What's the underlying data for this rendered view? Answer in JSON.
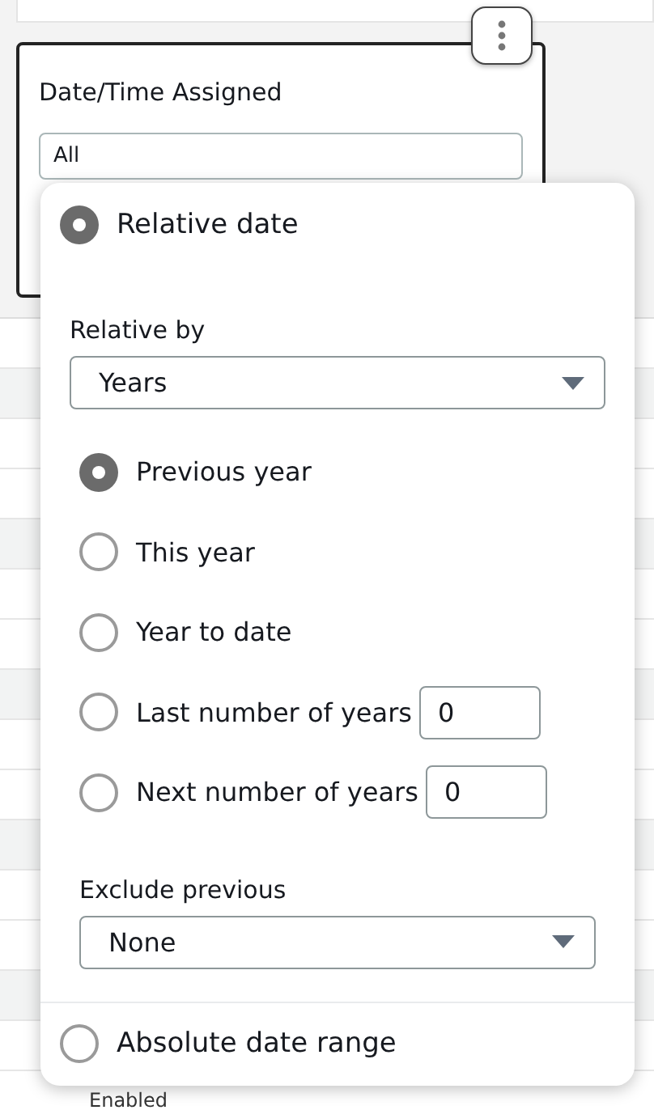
{
  "filter_card": {
    "title": "Date/Time Assigned",
    "value": "All"
  },
  "popup": {
    "modes": [
      {
        "label": "Relative date",
        "selected": true
      },
      {
        "label": "Absolute date range",
        "selected": false
      }
    ],
    "relative_by": {
      "label": "Relative by",
      "value": "Years"
    },
    "options": [
      {
        "label": "Previous year",
        "selected": true
      },
      {
        "label": "This year",
        "selected": false
      },
      {
        "label": "Year to date",
        "selected": false
      },
      {
        "label": "Last number of years",
        "selected": false,
        "input": "0"
      },
      {
        "label": "Next number of years",
        "selected": false,
        "input": "0"
      }
    ],
    "exclude": {
      "label": "Exclude previous",
      "value": "None"
    }
  },
  "table": {
    "cell": "Enabled"
  }
}
